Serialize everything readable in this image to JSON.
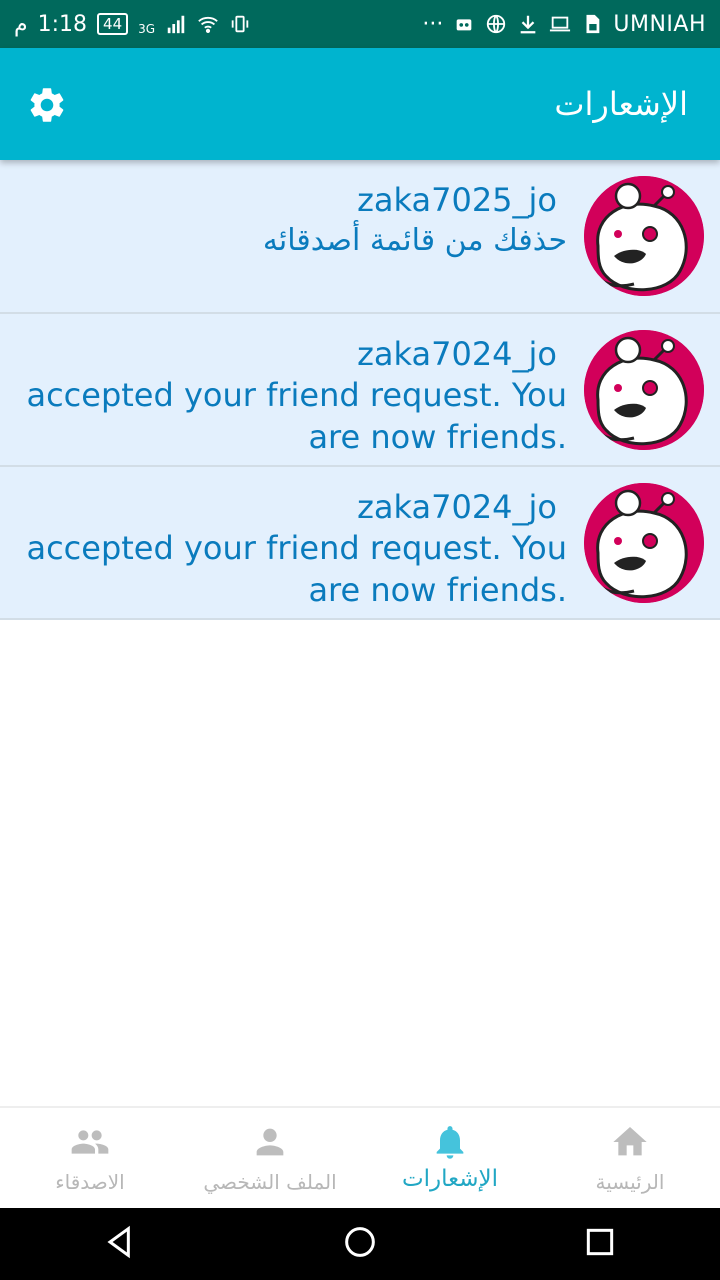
{
  "status_bar": {
    "time": "1:18",
    "am_pm": "م",
    "battery": "44",
    "network": "3G",
    "carrier": "UMNIAH"
  },
  "app_bar": {
    "title": "الإشعارات",
    "settings_icon": "gear-icon"
  },
  "notifications": [
    {
      "username": "zaka7025_jo",
      "message": "حذفك من قائمة أصدقائه",
      "lang": "ar"
    },
    {
      "username": "zaka7024_jo",
      "message": "accepted your friend request. You are now friends.",
      "lang": "en"
    },
    {
      "username": "zaka7024_jo",
      "message": "accepted your friend request. You are now friends.",
      "lang": "en"
    }
  ],
  "bottom_nav": [
    {
      "label": "الاصدقاء",
      "icon": "people-icon",
      "active": false
    },
    {
      "label": "الملف الشخصي",
      "icon": "person-icon",
      "active": false
    },
    {
      "label": "الإشعارات",
      "icon": "bell-icon",
      "active": true
    },
    {
      "label": "الرئيسية",
      "icon": "home-icon",
      "active": false
    }
  ],
  "colors": {
    "status_bar": "#00695c",
    "app_bar": "#00b4cf",
    "item_bg": "#e3f0fd",
    "text_blue": "#0a7bbd",
    "avatar_bg": "#d2005a",
    "nav_active": "#21a7c4",
    "nav_inactive": "#b7b7b7"
  }
}
